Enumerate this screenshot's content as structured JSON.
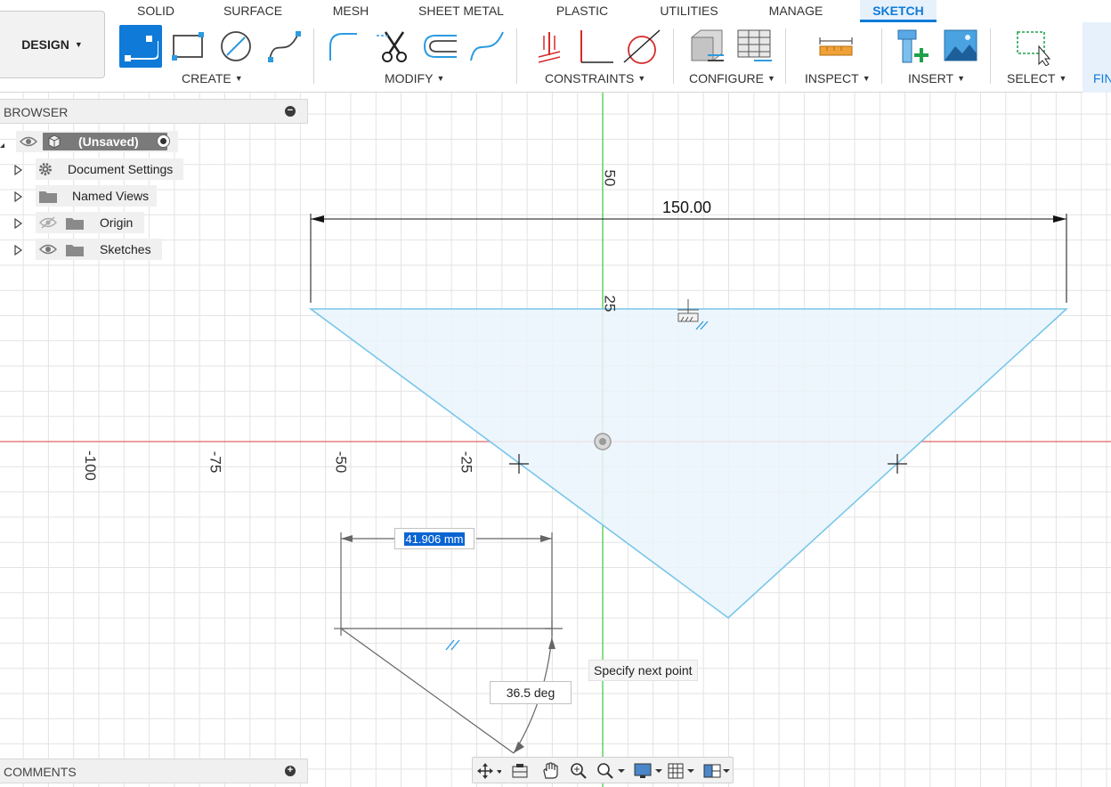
{
  "toolbar": {
    "workspace_label": "DESIGN",
    "tabs": [
      "SOLID",
      "SURFACE",
      "MESH",
      "SHEET METAL",
      "PLASTIC",
      "UTILITIES",
      "MANAGE",
      "SKETCH"
    ],
    "active_tab": "SKETCH",
    "groups": {
      "create": "CREATE",
      "modify": "MODIFY",
      "constraints": "CONSTRAINTS",
      "configure": "CONFIGURE",
      "inspect": "INSPECT",
      "insert": "INSERT",
      "select": "SELECT"
    },
    "finish_label": "FINISH SKETCH",
    "accent_color": "#0f7ad8"
  },
  "browser": {
    "title": "BROWSER",
    "items": [
      {
        "label": "(Unsaved)",
        "icon": "component-icon"
      },
      {
        "label": "Document Settings",
        "icon": "gear-icon"
      },
      {
        "label": "Named Views",
        "icon": "folder-icon"
      },
      {
        "label": "Origin",
        "icon": "folder-icon",
        "visibility": "hidden"
      },
      {
        "label": "Sketches",
        "icon": "folder-icon",
        "visibility": "visible"
      }
    ]
  },
  "comments": {
    "title": "COMMENTS"
  },
  "canvas": {
    "x_axis_labels": [
      "-100",
      "-75",
      "-50",
      "-25"
    ],
    "y_axis_labels": [
      "50",
      "25"
    ],
    "dimension_width": "150.00",
    "length_input_value": "41.906 mm",
    "angle_input_value": "36.5 deg",
    "tooltip": "Specify next point",
    "colors": {
      "x_axis": "#e06666",
      "y_axis": "#4cc94c",
      "profile_fill": "#eaf4fb",
      "profile_stroke": "#79c6ea",
      "selection_highlight": "#0a64d2"
    }
  },
  "navbar": {
    "icons": [
      "orbit-icon",
      "look-at-icon",
      "pan-icon",
      "zoom-icon",
      "zoom-window-icon",
      "display-settings-icon",
      "grid-icon",
      "viewports-icon"
    ]
  }
}
